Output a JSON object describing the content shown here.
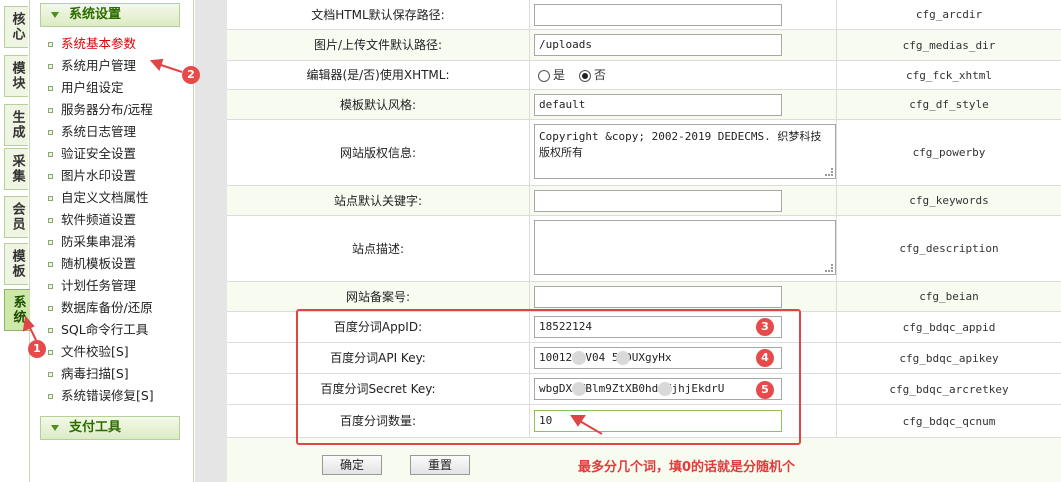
{
  "vtabs": [
    "核心",
    "模块",
    "生成",
    "采集",
    "会员",
    "模板",
    "系统"
  ],
  "menu": {
    "section_title": "系统设置",
    "footer_title": "支付工具",
    "items": [
      "系统基本参数",
      "系统用户管理",
      "用户组设定",
      "服务器分布/远程",
      "系统日志管理",
      "验证安全设置",
      "图片水印设置",
      "自定义文档属性",
      "软件频道设置",
      "防采集串混淆",
      "随机模板设置",
      "计划任务管理",
      "数据库备份/还原",
      "SQL命令行工具",
      "文件校验[S]",
      "病毒扫描[S]",
      "系统错误修复[S]"
    ]
  },
  "rows": [
    {
      "label": "文档HTML默认保存路径:",
      "value": "",
      "var": "cfg_arcdir"
    },
    {
      "label": "图片/上传文件默认路径:",
      "value": "/uploads",
      "var": "cfg_medias_dir"
    },
    {
      "label": "编辑器(是/否)使用XHTML:",
      "var": "cfg_fck_xhtml",
      "radio_yes": "是",
      "radio_no": "否"
    },
    {
      "label": "模板默认风格:",
      "value": "default",
      "var": "cfg_df_style"
    },
    {
      "label": "网站版权信息:",
      "value": "Copyright &copy; 2002-2019 DEDECMS. 织梦科技 版权所有",
      "var": "cfg_powerby"
    },
    {
      "label": "站点默认关键字:",
      "value": "",
      "var": "cfg_keywords"
    },
    {
      "label": "站点描述:",
      "value": "",
      "var": "cfg_description"
    },
    {
      "label": "网站备案号:",
      "value": "",
      "var": "cfg_beian"
    },
    {
      "label": "百度分词AppID:",
      "value": "18522124",
      "var": "cfg_bdqc_appid"
    },
    {
      "label": "百度分词API Key:",
      "value": "10012  LV04  5DDUXgyHx",
      "var": "cfg_bdqc_apikey"
    },
    {
      "label": "百度分词Secret Key:",
      "value": "wbgDX   MBlm9ZtXB0hd  YjhjEkdrU",
      "var": "cfg_bdqc_arcretkey"
    },
    {
      "label": "百度分词数量:",
      "value": "10",
      "var": "cfg_bdqc_qcnum"
    }
  ],
  "buttons": {
    "ok": "确定",
    "reset": "重置"
  },
  "hint": "最多分几个词，填0的话就是分随机个",
  "badges": [
    "1",
    "2",
    "3",
    "4",
    "5"
  ],
  "colors": {
    "accent": "#e04545",
    "menu_green": "#2b6b00"
  }
}
